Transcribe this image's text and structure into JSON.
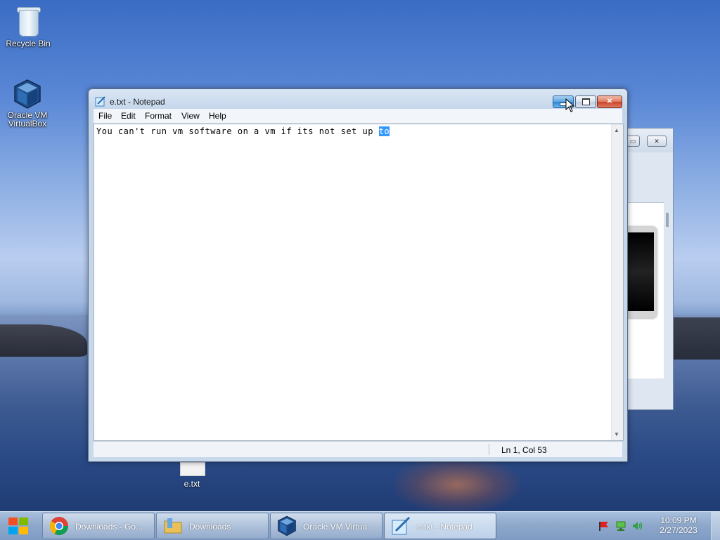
{
  "desktop": {
    "icons": [
      {
        "label": "Recycle Bin",
        "icon": "recycle-bin-icon"
      },
      {
        "label": "Oracle VM VirtualBox",
        "icon": "virtualbox-icon"
      },
      {
        "label": "e.txt",
        "icon": "text-file-icon"
      }
    ]
  },
  "notepad": {
    "title": "e.txt - Notepad",
    "menu": [
      "File",
      "Edit",
      "Format",
      "View",
      "Help"
    ],
    "text_before_selection": "You can't run vm software on a vm if its not set up ",
    "selected_text": "to",
    "status": "Ln 1, Col 53"
  },
  "taskbar": {
    "buttons": [
      {
        "label": "Downloads - Go...",
        "icon": "chrome-icon"
      },
      {
        "label": "Downloads",
        "icon": "folder-icon"
      },
      {
        "label": "Oracle VM Virtua...",
        "icon": "virtualbox-icon"
      },
      {
        "label": "e.txt - Notepad",
        "icon": "notepad-icon",
        "active": true
      }
    ],
    "clock": {
      "time": "10:09 PM",
      "date": "2/27/2023"
    }
  },
  "colors": {
    "selection": "#3399ff",
    "close_button": "#c8442b",
    "minimize_button": "#2f86d3"
  }
}
